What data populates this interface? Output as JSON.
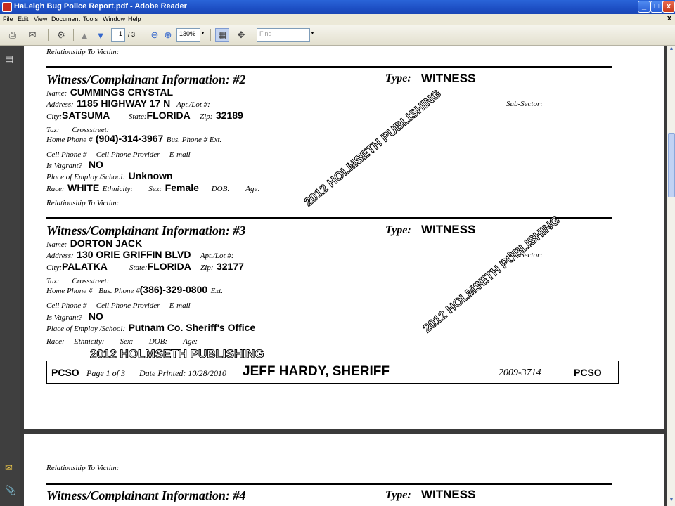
{
  "window": {
    "title": "HaLeigh Bug Police Report.pdf - Adobe Reader",
    "buttons": [
      "_",
      "□",
      "x"
    ]
  },
  "menu": {
    "items": [
      "File",
      "Edit",
      "View",
      "Document",
      "Tools",
      "Window",
      "Help"
    ],
    "close": "x"
  },
  "toolbar": {
    "page_current": "1",
    "page_total": "/ 3",
    "zoom": "130%",
    "find_placeholder": "Find"
  },
  "report": {
    "rel_top": {
      "label": "Relationship To Victim:"
    },
    "w2": {
      "title": "Witness/Complainant Information: #2",
      "type_label": "Type:",
      "type_value": "WITNESS",
      "name_label": "Name:",
      "name": "CUMMINGS CRYSTAL",
      "address_label": "Address:",
      "address": "1185 HIGHWAY 17  N",
      "apt_label": "Apt./Lot #:",
      "subsector_label": "Sub-Sector:",
      "city_label": "City:",
      "city": "SATSUMA",
      "state_label": "State:",
      "state": "FLORIDA",
      "zip_label": "Zip:",
      "zip": "32189",
      "taz_label": "Taz:",
      "cross_label": "Crossstreet:",
      "home_phone_label": "Home Phone #",
      "home_phone": "(904)-314-3967",
      "bus_phone_label": "Bus. Phone # Ext.",
      "cell_label": "Cell Phone #",
      "provider_label": "Cell Phone Provider",
      "email_label": "E-mail",
      "vagrant_label": "Is Vagrant?",
      "vagrant": "NO",
      "employ_label": "Place of Employ /School:",
      "employ": "Unknown",
      "race_label": "Race:",
      "race": "WHITE",
      "ethnicity_label": "Ethnicity:",
      "sex_label": "Sex:",
      "sex": "Female",
      "dob_label": "DOB:",
      "age_label": "Age:",
      "rel_label": "Relationship To Victim:"
    },
    "w3": {
      "title": "Witness/Complainant Information: #3",
      "type_label": "Type:",
      "type_value": "WITNESS",
      "name_label": "Name:",
      "name": "DORTON JACK",
      "address_label": "Address:",
      "address": "130 ORIE GRIFFIN BLVD",
      "apt_label": "Apt./Lot #:",
      "subsector_label": "Sub-Sector:",
      "city_label": "City:",
      "city": "PALATKA",
      "state_label": "State:",
      "state": "FLORIDA",
      "zip_label": "Zip:",
      "zip": "32177",
      "taz_label": "Taz:",
      "cross_label": "Crossstreet:",
      "home_phone_label": "Home Phone #",
      "bus_phone_label": "Bus. Phone #",
      "bus_phone": "(386)-329-0800",
      "ext_label": "Ext.",
      "cell_label": "Cell Phone #",
      "provider_label": "Cell Phone Provider",
      "email_label": "E-mail",
      "vagrant_label": "Is Vagrant?",
      "vagrant": "NO",
      "employ_label": "Place of Employ /School:",
      "employ": "Putnam Co. Sheriff's Office",
      "race_label": "Race:",
      "ethnicity_label": "Ethnicity:",
      "sex_label": "Sex:",
      "dob_label": "DOB:",
      "age_label": "Age:"
    },
    "footer": {
      "left": "PCSO",
      "page": "Page 1  of 3",
      "printed": "Date Printed: 10/28/2010",
      "sheriff": "JEFF HARDY, SHERIFF",
      "case": "2009-3714",
      "right": "PCSO"
    },
    "page2": {
      "rel_label": "Relationship To Victim:",
      "w4_title": "Witness/Complainant Information: #4",
      "type_label": "Type:",
      "type_value": "WITNESS"
    }
  },
  "watermarks": [
    "2012 HOLMSETH PUBLISHING",
    "2012 HOLMSETH PUBLISHING",
    "2012 HOLMSETH PUBLISHING"
  ]
}
